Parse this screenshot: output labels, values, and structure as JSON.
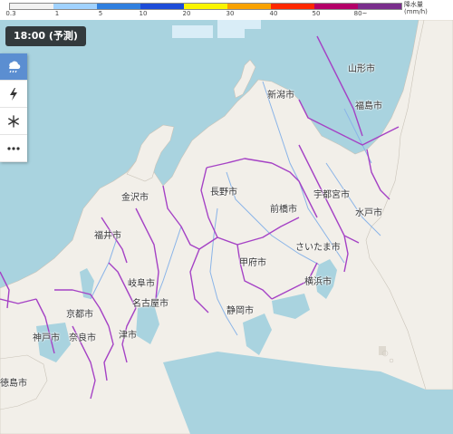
{
  "legend": {
    "ticks": [
      "0.3",
      "1",
      "5",
      "10",
      "20",
      "30",
      "40",
      "50",
      "80~"
    ],
    "unit_line1": "降水量",
    "unit_line2": "(mm/h)",
    "colors": [
      "#f2f2f2",
      "#a0d2ff",
      "#2f7fdf",
      "#1d4cd8",
      "#faf500",
      "#f8a200",
      "#ff2800",
      "#b40068",
      "#7a2e8c"
    ]
  },
  "time_chip": "18:00 (予測)",
  "layer_buttons": [
    {
      "icon": "rain-cloud-icon",
      "active": true
    },
    {
      "icon": "lightning-icon",
      "active": false
    },
    {
      "icon": "snowflake-icon",
      "active": false
    },
    {
      "icon": "more-icon",
      "active": false
    }
  ],
  "cities": {
    "yamagata": "山形市",
    "niigata": "新潟市",
    "fukushima": "福島市",
    "kanazawa": "金沢市",
    "nagano": "長野市",
    "utsunomiya": "宇都宮市",
    "maebashi": "前橋市",
    "mito": "水戸市",
    "fukui": "福井市",
    "saitama": "さいたま市",
    "kofu": "甲府市",
    "gifu": "岐阜市",
    "yokohama": "横浜市",
    "nagoya": "名古屋市",
    "kyoto": "京都市",
    "shizuoka": "静岡市",
    "kobe": "神戸市",
    "nara": "奈良市",
    "tsu": "津市",
    "tokushima": "徳島市"
  },
  "colors": {
    "sea": "#a9d3df",
    "land": "#f2efe9",
    "prefecture_border": "#a542c5",
    "river": "#8ab4e8"
  }
}
